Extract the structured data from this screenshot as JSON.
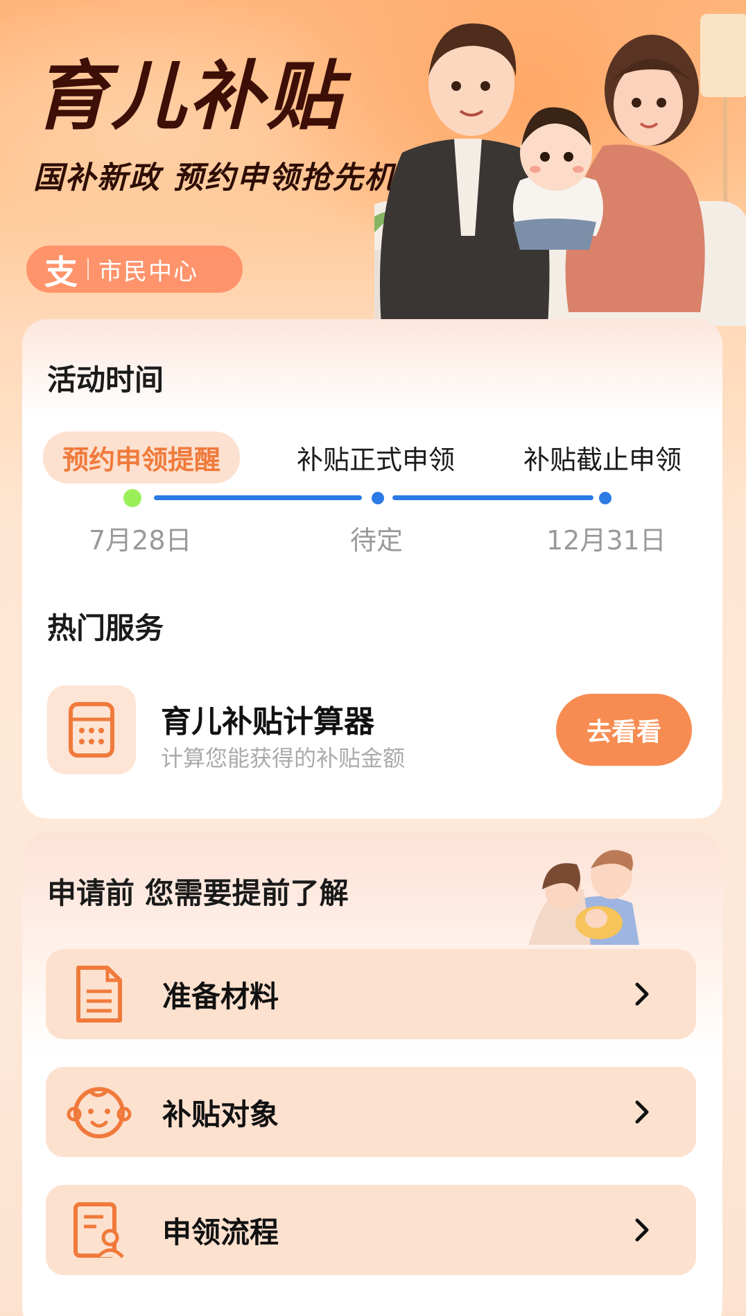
{
  "hero": {
    "title": "育儿补贴",
    "subtitle": "国补新政 预约申领抢先机",
    "badge_icon": "支",
    "badge_text": "市民中心"
  },
  "activity": {
    "title": "活动时间",
    "stages": [
      {
        "label": "预约申领提醒",
        "date": "7月28日",
        "active": true
      },
      {
        "label": "补贴正式申领",
        "date": "待定",
        "active": false
      },
      {
        "label": "补贴截止申领",
        "date": "12月31日",
        "active": false
      }
    ]
  },
  "hot_services": {
    "title": "热门服务",
    "calculator": {
      "title": "育儿补贴计算器",
      "desc": "计算您能获得的补贴金额",
      "button": "去看看",
      "icon": "calculator-icon"
    }
  },
  "before_apply": {
    "title": "申请前 您需要提前了解",
    "items": [
      {
        "label": "准备材料",
        "icon": "document-icon"
      },
      {
        "label": "补贴对象",
        "icon": "baby-face-icon"
      },
      {
        "label": "申领流程",
        "icon": "form-user-icon"
      }
    ]
  },
  "colors": {
    "accent": "#f78c52",
    "timeline_blue": "#2c7be5",
    "active_dot": "#9bf05a"
  }
}
